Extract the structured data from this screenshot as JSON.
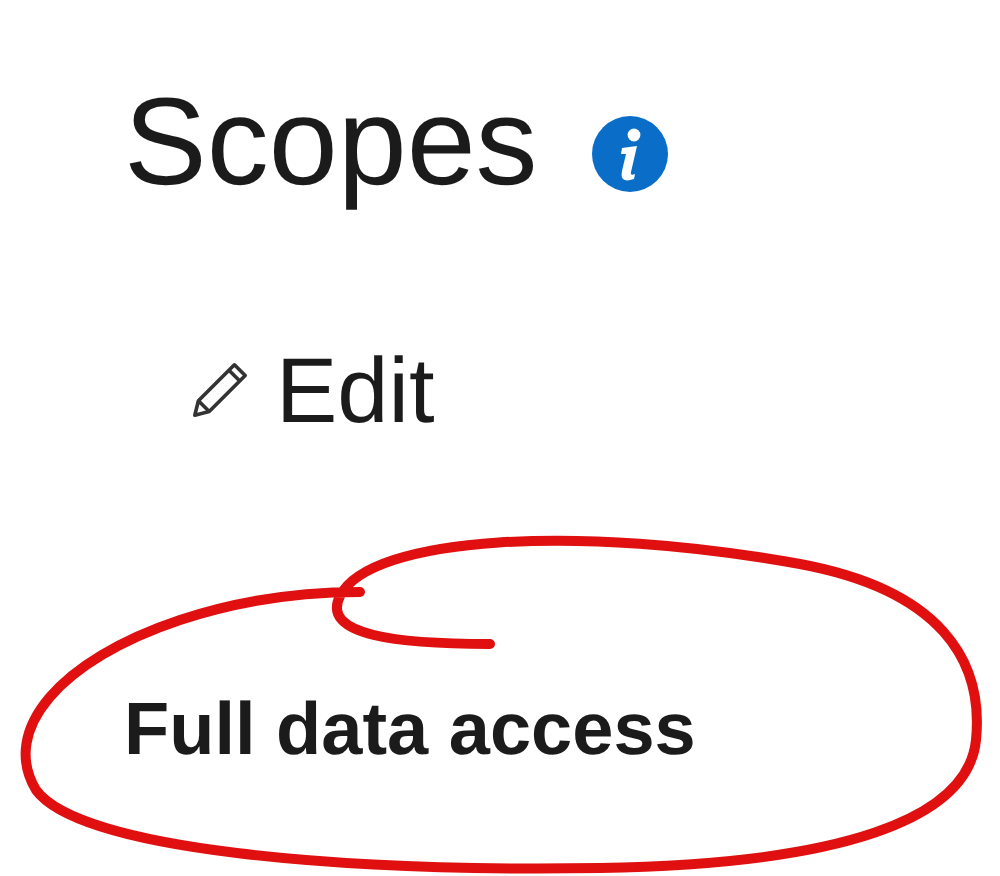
{
  "heading": "Scopes",
  "edit_button": "Edit",
  "scope": "Full data access"
}
